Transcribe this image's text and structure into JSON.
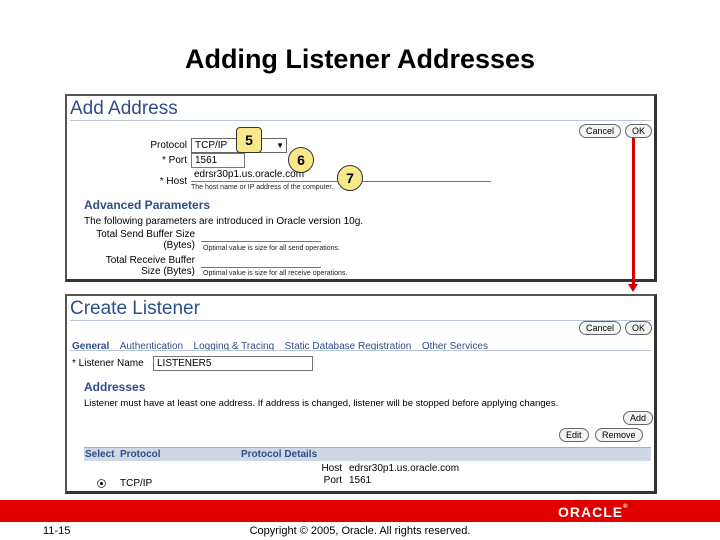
{
  "slide": {
    "title": "Adding Listener Addresses",
    "page_number": "11-15",
    "copyright": "Copyright © 2005, Oracle. All rights reserved.",
    "logo": "ORACLE",
    "accent_color": "#e00000"
  },
  "add_address": {
    "title": "Add Address",
    "cancel_label": "Cancel",
    "ok_label": "OK",
    "protocol_label": "Protocol",
    "protocol_value": "TCP/IP",
    "port_label": "* Port",
    "port_value": "1561",
    "host_label": "* Host",
    "host_value": "edrsr30p1.us.oracle.com",
    "host_hint": "The host name or IP address of the computer.",
    "advanced_heading": "Advanced Parameters",
    "advanced_intro": "The following parameters are introduced in Oracle version 10g.",
    "send_buffer_label_1": "Total Send Buffer Size",
    "send_buffer_label_2": "(Bytes)",
    "send_buffer_hint": "Optimal value is size for all send operations.",
    "receive_buffer_label_1": "Total Receive Buffer",
    "receive_buffer_label_2": "Size (Bytes)",
    "receive_buffer_hint": "Optimal value is size for all receive operations."
  },
  "callouts": [
    "5",
    "6",
    "7"
  ],
  "create_listener": {
    "title": "Create Listener",
    "cancel_label": "Cancel",
    "ok_label": "OK",
    "tabs": [
      "General",
      "Authentication",
      "Logging & Tracing",
      "Static Database Registration",
      "Other Services"
    ],
    "listener_name_label": "* Listener Name",
    "listener_name_value": "LISTENER5",
    "addresses_heading": "Addresses",
    "addresses_text": "Listener must have at least one address. If address is changed, listener will be stopped before applying changes.",
    "add_label": "Add",
    "edit_label": "Edit",
    "remove_label": "Remove",
    "table": {
      "headers": [
        "Select",
        "Protocol",
        "Protocol Details"
      ],
      "row": {
        "protocol": "TCP/IP",
        "host_label": "Host",
        "host_value": "edrsr30p1.us.oracle.com",
        "port_label": "Port",
        "port_value": "1561"
      }
    }
  }
}
